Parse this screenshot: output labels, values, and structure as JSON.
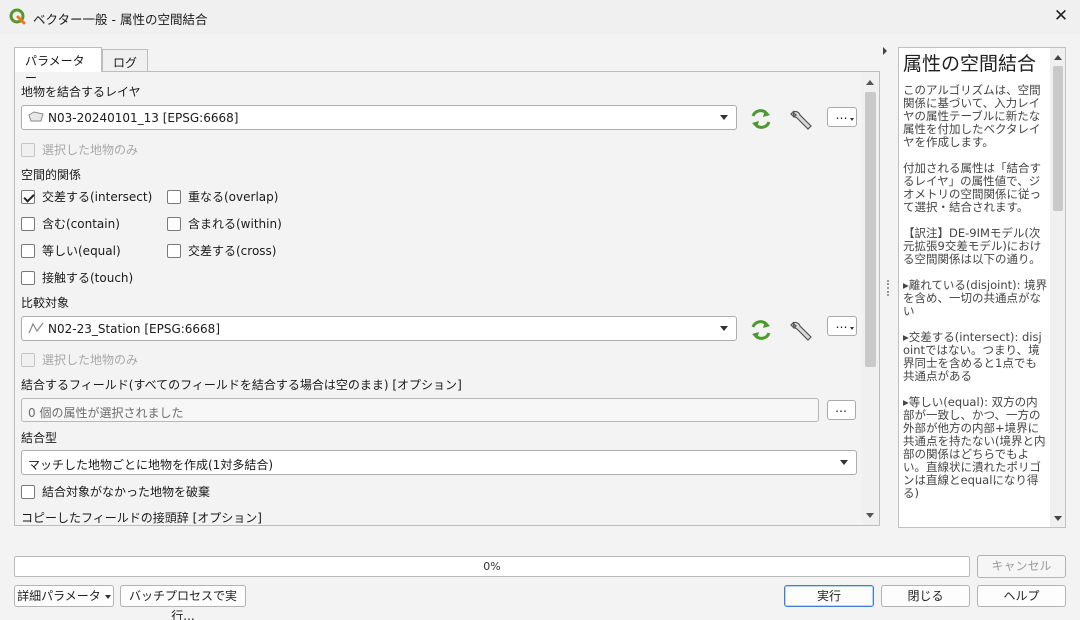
{
  "window": {
    "title": "ベクター一般 - 属性の空間結合",
    "close_glyph": "✕",
    "logo_icon": "qgis-logo-icon"
  },
  "tabs": [
    {
      "label": "パラメーター",
      "active": true
    },
    {
      "label": "ログ",
      "active": false
    }
  ],
  "params": {
    "join_layer": {
      "label": "地物を結合するレイヤ",
      "value": "N03-20240101_13 [EPSG:6668]",
      "icon": "polygon-layer-icon",
      "selected_only": "選択した地物のみ"
    },
    "spatial_relation": {
      "label": "空間的関係",
      "options": [
        {
          "label": "交差する(intersect)",
          "checked": true
        },
        {
          "label": "重なる(overlap)",
          "checked": false
        },
        {
          "label": "含む(contain)",
          "checked": false
        },
        {
          "label": "含まれる(within)",
          "checked": false
        },
        {
          "label": "等しい(equal)",
          "checked": false
        },
        {
          "label": "交差する(cross)",
          "checked": false
        },
        {
          "label": "接触する(touch)",
          "checked": false
        }
      ]
    },
    "compare_layer": {
      "label": "比較対象",
      "value": "N02-23_Station [EPSG:6668]",
      "icon": "line-layer-icon",
      "selected_only": "選択した地物のみ"
    },
    "fields": {
      "label": "結合するフィールド(すべてのフィールドを結合する場合は空のまま) [オプション]",
      "value": "0 個の属性が選択されました"
    },
    "join_type": {
      "label": "結合型",
      "value": "マッチした地物ごとに地物を作成(1対多結合)"
    },
    "discard": {
      "label": "結合対象がなかった地物を破棄",
      "checked": false
    },
    "prefix": {
      "label": "コピーしたフィールドの接頭辞 [オプション]"
    },
    "ellipsis": "…"
  },
  "help": {
    "title": "属性の空間結合",
    "paragraphs": [
      "このアルゴリズムは、空間関係に基づいて、入力レイヤの属性テーブルに新たな属性を付加したベクタレイヤを作成します。",
      "付加される属性は「結合するレイヤ」の属性値で、ジオメトリの空間関係に従って選択・結合されます。",
      "【訳注】DE-9IMモデル(次元拡張9交差モデル)における空間関係は以下の通り。",
      "▸離れている(disjoint): 境界を含め、一切の共通点がない",
      "▸交差する(intersect): disjointではない。つまり、境界同士を含めると1点でも共通点がある",
      "▸等しい(equal): 双方の内部が一致し、かつ、一方の外部が他方の内部+境界に共通点を持たない(境界と内部の関係はどちらでもよい。直線状に潰れたポリゴンは直線とequalになり得る)"
    ]
  },
  "progress": {
    "text": "0%",
    "value": 0
  },
  "buttons": {
    "cancel": "キャンセル",
    "advanced": "詳細パラメータ",
    "batch": "バッチプロセスで実行...",
    "run": "実行",
    "close": "閉じる",
    "help": "ヘルプ"
  }
}
